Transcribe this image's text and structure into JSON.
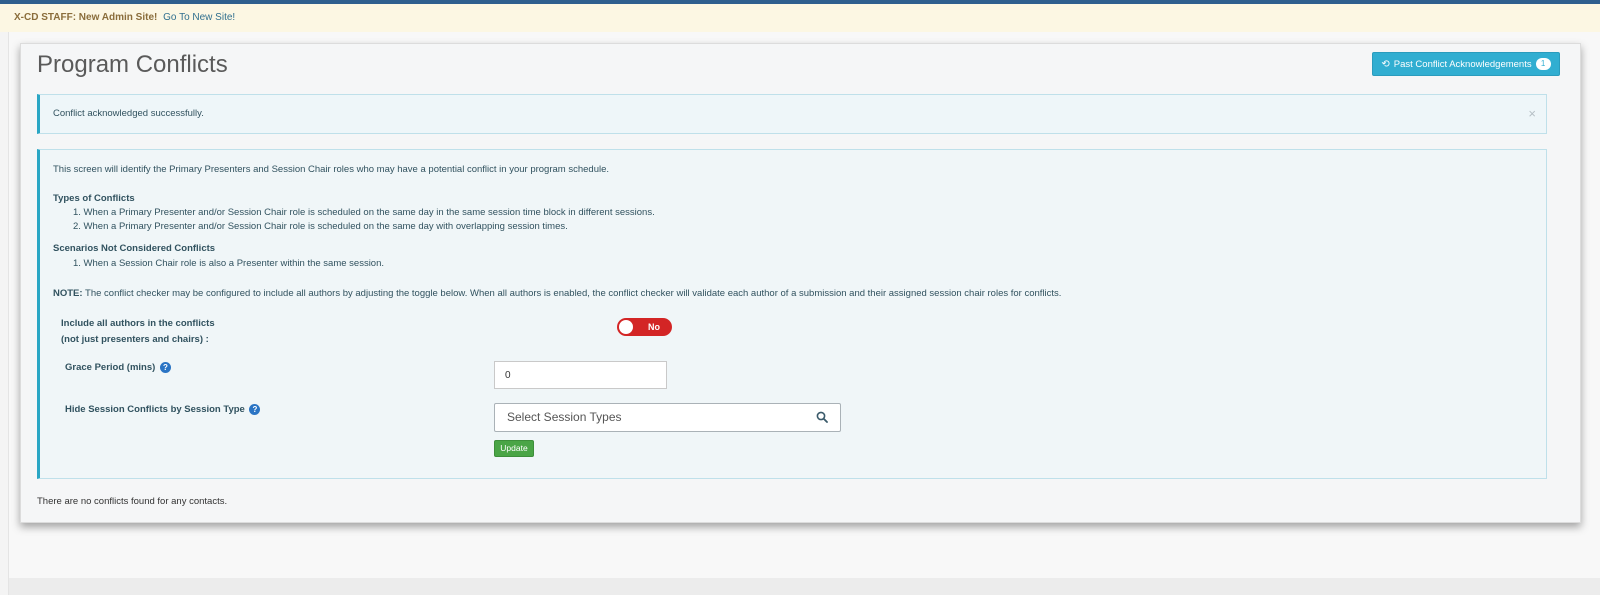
{
  "staff_bar": {
    "label": "X-CD STAFF: New Admin Site!",
    "link": "Go To New Site!"
  },
  "page": {
    "title": "Program Conflicts",
    "past_button": {
      "label": "Past Conflict Acknowledgements",
      "badge": "1",
      "icon": "history-icon"
    },
    "alert": {
      "message": "Conflict acknowledged successfully.",
      "close": "×"
    },
    "info": {
      "intro": "This screen will identify the Primary Presenters and Session Chair roles who may have a potential conflict in your program schedule.",
      "types_heading": "Types of Conflicts",
      "types": [
        "1. When a Primary Presenter and/or Session Chair role is scheduled on the same day in the same session time block in different sessions.",
        "2. When a Primary Presenter and/or Session Chair role is scheduled on the same day with overlapping session times."
      ],
      "scenarios_heading": "Scenarios Not Considered Conflicts",
      "scenarios": [
        "1. When a Session Chair role is also a Presenter within the same session."
      ],
      "note_label": "NOTE:",
      "note_text": " The conflict checker may be configured to include all authors by adjusting the toggle below. When all authors is enabled, the conflict checker will validate each author of a submission and their assigned session chair roles for conflicts.",
      "include_label_line1": "Include all authors in the conflicts",
      "include_label_line2": "(not just presenters and chairs) :",
      "toggle_value": "No",
      "grace_label": "Grace Period (mins)",
      "grace_value": "0",
      "hide_label": "Hide Session Conflicts by Session Type",
      "session_placeholder": "Select Session Types",
      "update_label": "Update",
      "help": "?"
    },
    "no_conflicts": "There are no conflicts found for any contacts."
  },
  "colors": {
    "accent": "#31aed1",
    "toggle_off": "#d32525",
    "update": "#4aa546",
    "topbar": "#2f5f8e"
  }
}
